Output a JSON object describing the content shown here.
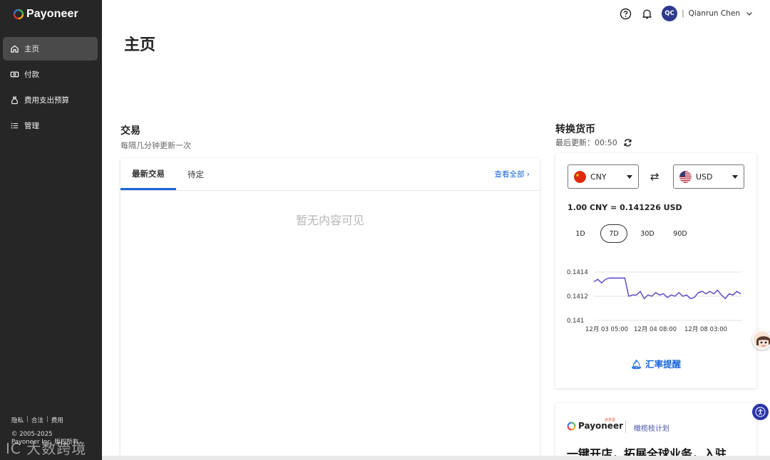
{
  "brand": {
    "name": "Payoneer"
  },
  "sidebar": {
    "items": [
      {
        "label": "主页",
        "icon": "home-icon",
        "active": true
      },
      {
        "label": "付款",
        "icon": "payment-icon",
        "active": false
      },
      {
        "label": "费用支出预算",
        "icon": "budget-bag-icon",
        "active": false
      },
      {
        "label": "管理",
        "icon": "list-icon",
        "active": false
      }
    ],
    "footer_links": [
      "隐私",
      "合法",
      "费用"
    ],
    "copyright_line1": "© 2005-2025",
    "copyright_line2": "Payoneer Inc. 版权所有",
    "watermark": "IC 大数跨境"
  },
  "topbar": {
    "user_initials": "QC",
    "user_name": "Qianrun Chen"
  },
  "page": {
    "title": "主页"
  },
  "transactions": {
    "title": "交易",
    "subtitle": "每隔几分钟更新一次",
    "tabs": [
      "最新交易",
      "待定"
    ],
    "view_all": "查看全部",
    "empty_text": "暂无内容可见"
  },
  "converter": {
    "title": "转换货币",
    "last_update_label": "最后更新：",
    "last_update_time": "00:50",
    "from_currency": "CNY",
    "to_currency": "USD",
    "rate_text": "1.00 CNY = 0.141226 USD",
    "periods": [
      "1D",
      "7D",
      "30D",
      "90D"
    ],
    "active_period": "7D",
    "alert_label": "汇率提醒",
    "line_color": "#5b3fc4"
  },
  "chart_data": {
    "type": "line",
    "x_labels": [
      "12月 03 05:00",
      "12月 04 08:00",
      "12月 08 03:00"
    ],
    "y_ticks": [
      0.1414,
      0.1412,
      0.141
    ],
    "ylim": [
      0.141,
      0.1414
    ],
    "series": [
      {
        "values": [
          0.14132,
          0.14134,
          0.14131,
          0.14134,
          0.14135,
          0.14135,
          0.14135,
          0.14135,
          0.14135,
          0.1412,
          0.14121,
          0.14121,
          0.14124,
          0.14118,
          0.14121,
          0.1412,
          0.14123,
          0.14121,
          0.14122,
          0.14119,
          0.14121,
          0.1412,
          0.14123,
          0.1412,
          0.14121,
          0.14118,
          0.14119,
          0.14123,
          0.14124,
          0.14122,
          0.14124,
          0.14122,
          0.14125,
          0.14121,
          0.14118,
          0.14122,
          0.14121,
          0.14124,
          0.14122
        ]
      }
    ],
    "grid": true
  },
  "promo": {
    "brand": "Payoneer",
    "brand_tag": "派安盈",
    "partner": "橄榄枝计划",
    "headline": "一键开店，拓展全球业务，入驻"
  }
}
